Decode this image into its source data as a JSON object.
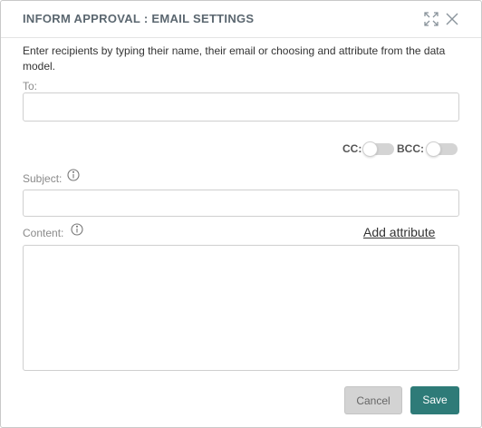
{
  "dialog": {
    "title": "INFORM APPROVAL : EMAIL SETTINGS",
    "icons": {
      "expand": "expand-icon",
      "close": "close-icon"
    }
  },
  "intro_text": "Enter recipients by typing their name, their email or choosing and attribute from the data model.",
  "to": {
    "label": "To:",
    "value": "",
    "placeholder": ""
  },
  "toggles": {
    "cc": {
      "label": "CC:",
      "on": false
    },
    "bcc": {
      "label": "BCC:",
      "on": false
    }
  },
  "subject": {
    "label": "Subject:",
    "value": "",
    "placeholder": "",
    "icon": "info-icon"
  },
  "content": {
    "label": "Content:",
    "value": "",
    "placeholder": "",
    "icon": "info-icon"
  },
  "add_attribute_label": "Add attribute",
  "buttons": {
    "cancel": "Cancel",
    "save": "Save"
  },
  "colors": {
    "accent": "#2e7b78",
    "title": "#5b6770",
    "cancel_bg": "#d3d3d3",
    "toggle_off": "#d4d4d4"
  }
}
